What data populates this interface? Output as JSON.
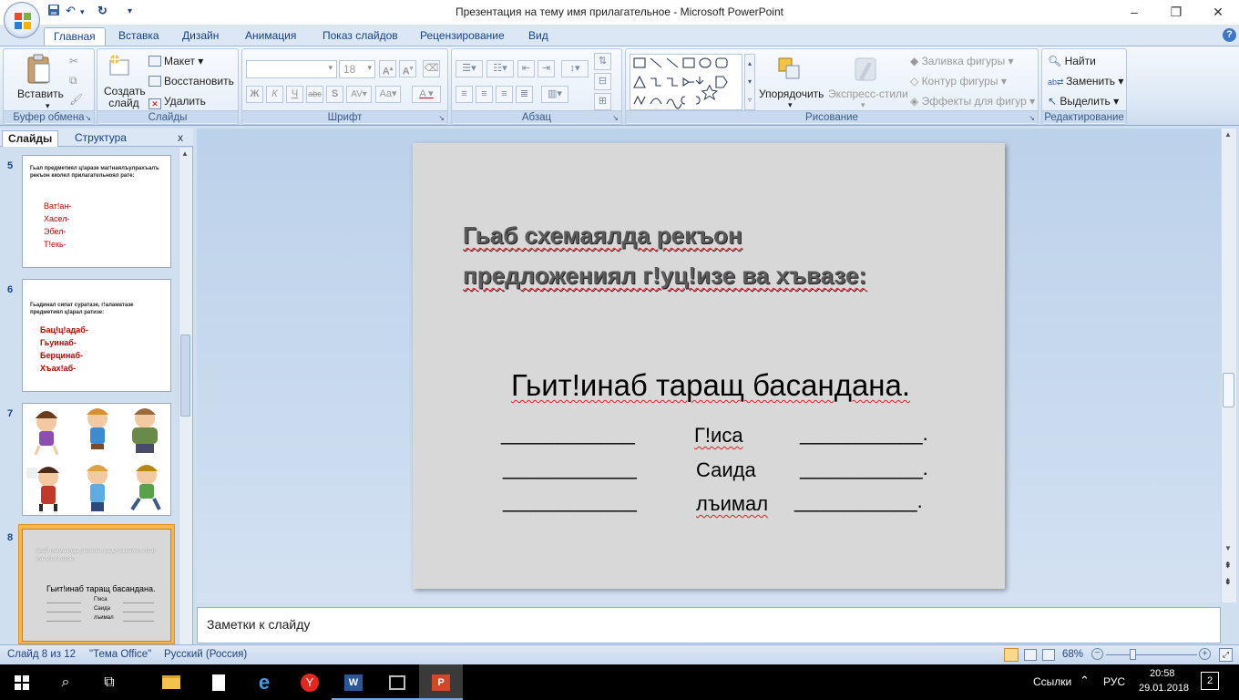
{
  "window": {
    "title": "Презентация на тему имя прилагательное - Microsoft PowerPoint",
    "minimize": "–",
    "maximize": "❐",
    "close": "✕"
  },
  "tabs": [
    "Главная",
    "Вставка",
    "Дизайн",
    "Анимация",
    "Показ слайдов",
    "Рецензирование",
    "Вид"
  ],
  "ribbon": {
    "clipboard": {
      "paste": "Вставить",
      "label": "Буфер обмена"
    },
    "slides": {
      "new_slide": "Создать слайд",
      "layout": "Макет",
      "reset": "Восстановить",
      "delete": "Удалить",
      "label": "Слайды"
    },
    "font": {
      "font_size": "18",
      "label": "Шрифт"
    },
    "paragraph": {
      "label": "Абзац"
    },
    "drawing": {
      "arrange": "Упорядочить",
      "quick_styles": "Экспресс-стили",
      "fill": "Заливка фигуры",
      "outline": "Контур фигуры",
      "effects": "Эффекты для фигур",
      "label": "Рисование"
    },
    "editing": {
      "find": "Найти",
      "replace": "Заменить",
      "select": "Выделить",
      "label": "Редактирование"
    }
  },
  "left_pane": {
    "tab_slides": "Слайды",
    "tab_outline": "Структура",
    "close": "x",
    "thumbs": [
      {
        "num": "5",
        "question": "Гьал предметиял ц!аразе маг!наялъулрахъалъ рекъон кколел прилагательноял рате:",
        "words": [
          "Ват!ан-",
          "Хасел-",
          "Эбел-",
          "Т!екь-"
        ]
      },
      {
        "num": "6",
        "question": "Гьадинал сипат суратазе, г!аламатазе предметиял ц!арал ратизе:",
        "words": [
          "Бац!ц!адаб-",
          "Гьуинаб-",
          "Берцинаб-",
          "Хъах!аб-"
        ]
      },
      {
        "num": "7"
      },
      {
        "num": "8",
        "title": "Гьаб схемаялда рекъон предложениял г!уц!изе ва хъвазе:",
        "sentence": "Гьит!инаб  таращ басандана.",
        "names": [
          "Г!иса",
          "Саида",
          "лъимал"
        ]
      }
    ]
  },
  "slide": {
    "title_line1": "Гьаб схемаялда рекъон",
    "title_line2": "предложениял г!уц!изе ва хъвазе:",
    "sentence": "Гьит!инаб  таращ басандана.",
    "rows": [
      {
        "left": "____________",
        "word": "Г!иса",
        "right": "___________."
      },
      {
        "left": "____________",
        "word": "Саида",
        "right": "___________."
      },
      {
        "left": "____________",
        "word": "лъимал",
        "right": "___________."
      }
    ]
  },
  "notes_placeholder": "Заметки к слайду",
  "status": {
    "slide_of": "Слайд 8 из 12",
    "theme": "\"Тема Office\"",
    "language": "Русский (Россия)",
    "zoom": "68%"
  },
  "taskbar": {
    "links": "Ссылки",
    "lang": "РУС",
    "time": "20:58",
    "date": "29.01.2018",
    "notifications": "2"
  },
  "colors": {
    "ribbon_bg": "#dce8f5",
    "accent": "#15428b",
    "slide_bg": "#d8d8d8",
    "error_underline": "#e02020",
    "active_thumb": "#f8b54a"
  }
}
